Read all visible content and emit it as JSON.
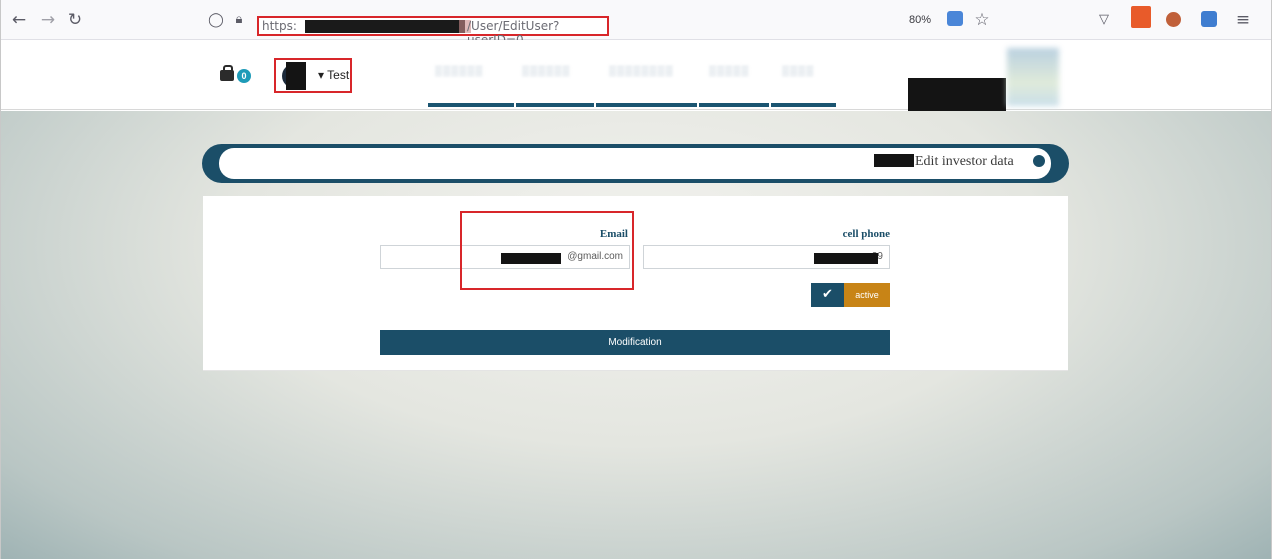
{
  "browser": {
    "nav_back": "←",
    "nav_forward": "→",
    "reload": "↻",
    "shield": "◯",
    "lock": "🔒︎",
    "url_scheme": "https:",
    "url_path": "/User/EditUser?userID=0",
    "zoom": "80%",
    "bookmark": "☆",
    "pocket": "▽",
    "menu": "≡"
  },
  "header": {
    "cart_count": "0",
    "user_name": "▾ Test",
    "nav_items": [
      "▒▒▒▒▒▒",
      "▒▒▒▒▒▒",
      "▒▒▒▒▒▒▒▒",
      "▒▒▒▒▒",
      "▒▒▒▒"
    ]
  },
  "page": {
    "title": "Edit investor data",
    "email_label": "Email",
    "email_value": "@gmail.com",
    "phone_label": "cell phone",
    "phone_value": "99",
    "active_check": "✔",
    "active_label": "active",
    "submit_label": "Modification"
  },
  "colors": {
    "accent": "#1b4e68",
    "active": "#c88416",
    "highlight": "#d8262a"
  }
}
